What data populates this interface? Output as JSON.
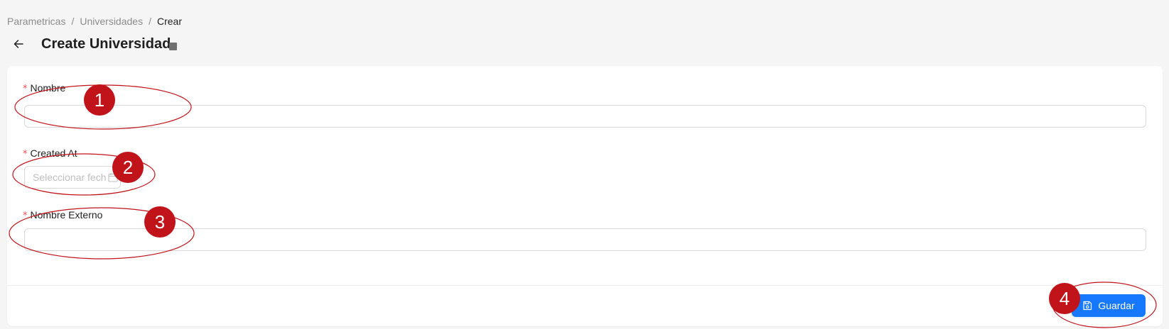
{
  "breadcrumb": {
    "items": [
      "Parametricas",
      "Universidades",
      "Crear"
    ],
    "separator": "/"
  },
  "header": {
    "back_icon": "arrow-left-icon",
    "title": "Create Universidad"
  },
  "form": {
    "required_mark": "*",
    "fields": {
      "nombre": {
        "label": "Nombre",
        "value": "",
        "placeholder": ""
      },
      "created_at": {
        "label": "Created At",
        "value": "",
        "placeholder": "Seleccionar fecha",
        "icon": "calendar-icon"
      },
      "nombre_externo": {
        "label": "Nombre Externo",
        "value": "",
        "placeholder": ""
      }
    }
  },
  "footer": {
    "save_label": "Guardar",
    "save_icon": "save-icon"
  },
  "annotations": {
    "badges": [
      "1",
      "2",
      "3",
      "4"
    ],
    "color": "#c0131a"
  },
  "colors": {
    "primary": "#1677ff",
    "required": "#ff4d4f",
    "background": "#f5f5f5"
  }
}
